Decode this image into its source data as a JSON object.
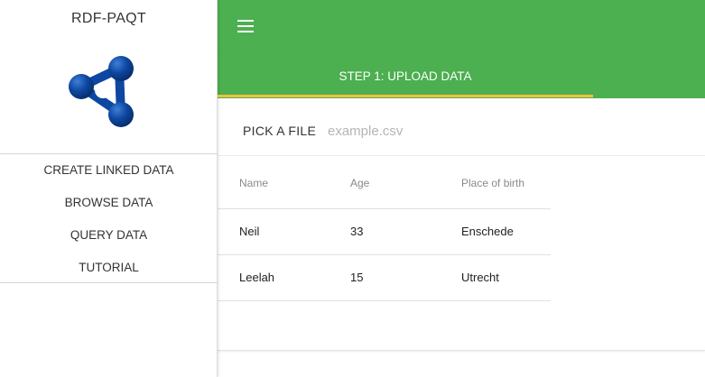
{
  "app": {
    "title": "RDF-PAQT"
  },
  "colors": {
    "primary": "#4caf50",
    "accent": "#f3c03a",
    "logo": "#0d47a1"
  },
  "sidebar": {
    "items": [
      {
        "label": "CREATE LINKED DATA"
      },
      {
        "label": "BROWSE DATA"
      },
      {
        "label": "QUERY DATA"
      },
      {
        "label": "TUTORIAL"
      }
    ]
  },
  "topbar": {
    "menu_icon": "hamburger-menu-icon"
  },
  "stepper": {
    "active_step_label": "STEP 1: UPLOAD DATA"
  },
  "upload": {
    "pick_label": "PICK A FILE",
    "file_placeholder": "example.csv",
    "file_value": ""
  },
  "table": {
    "headers": [
      "Name",
      "Age",
      "Place of birth"
    ],
    "rows": [
      [
        "Neil",
        "33",
        "Enschede"
      ],
      [
        "Leelah",
        "15",
        "Utrecht"
      ]
    ]
  }
}
